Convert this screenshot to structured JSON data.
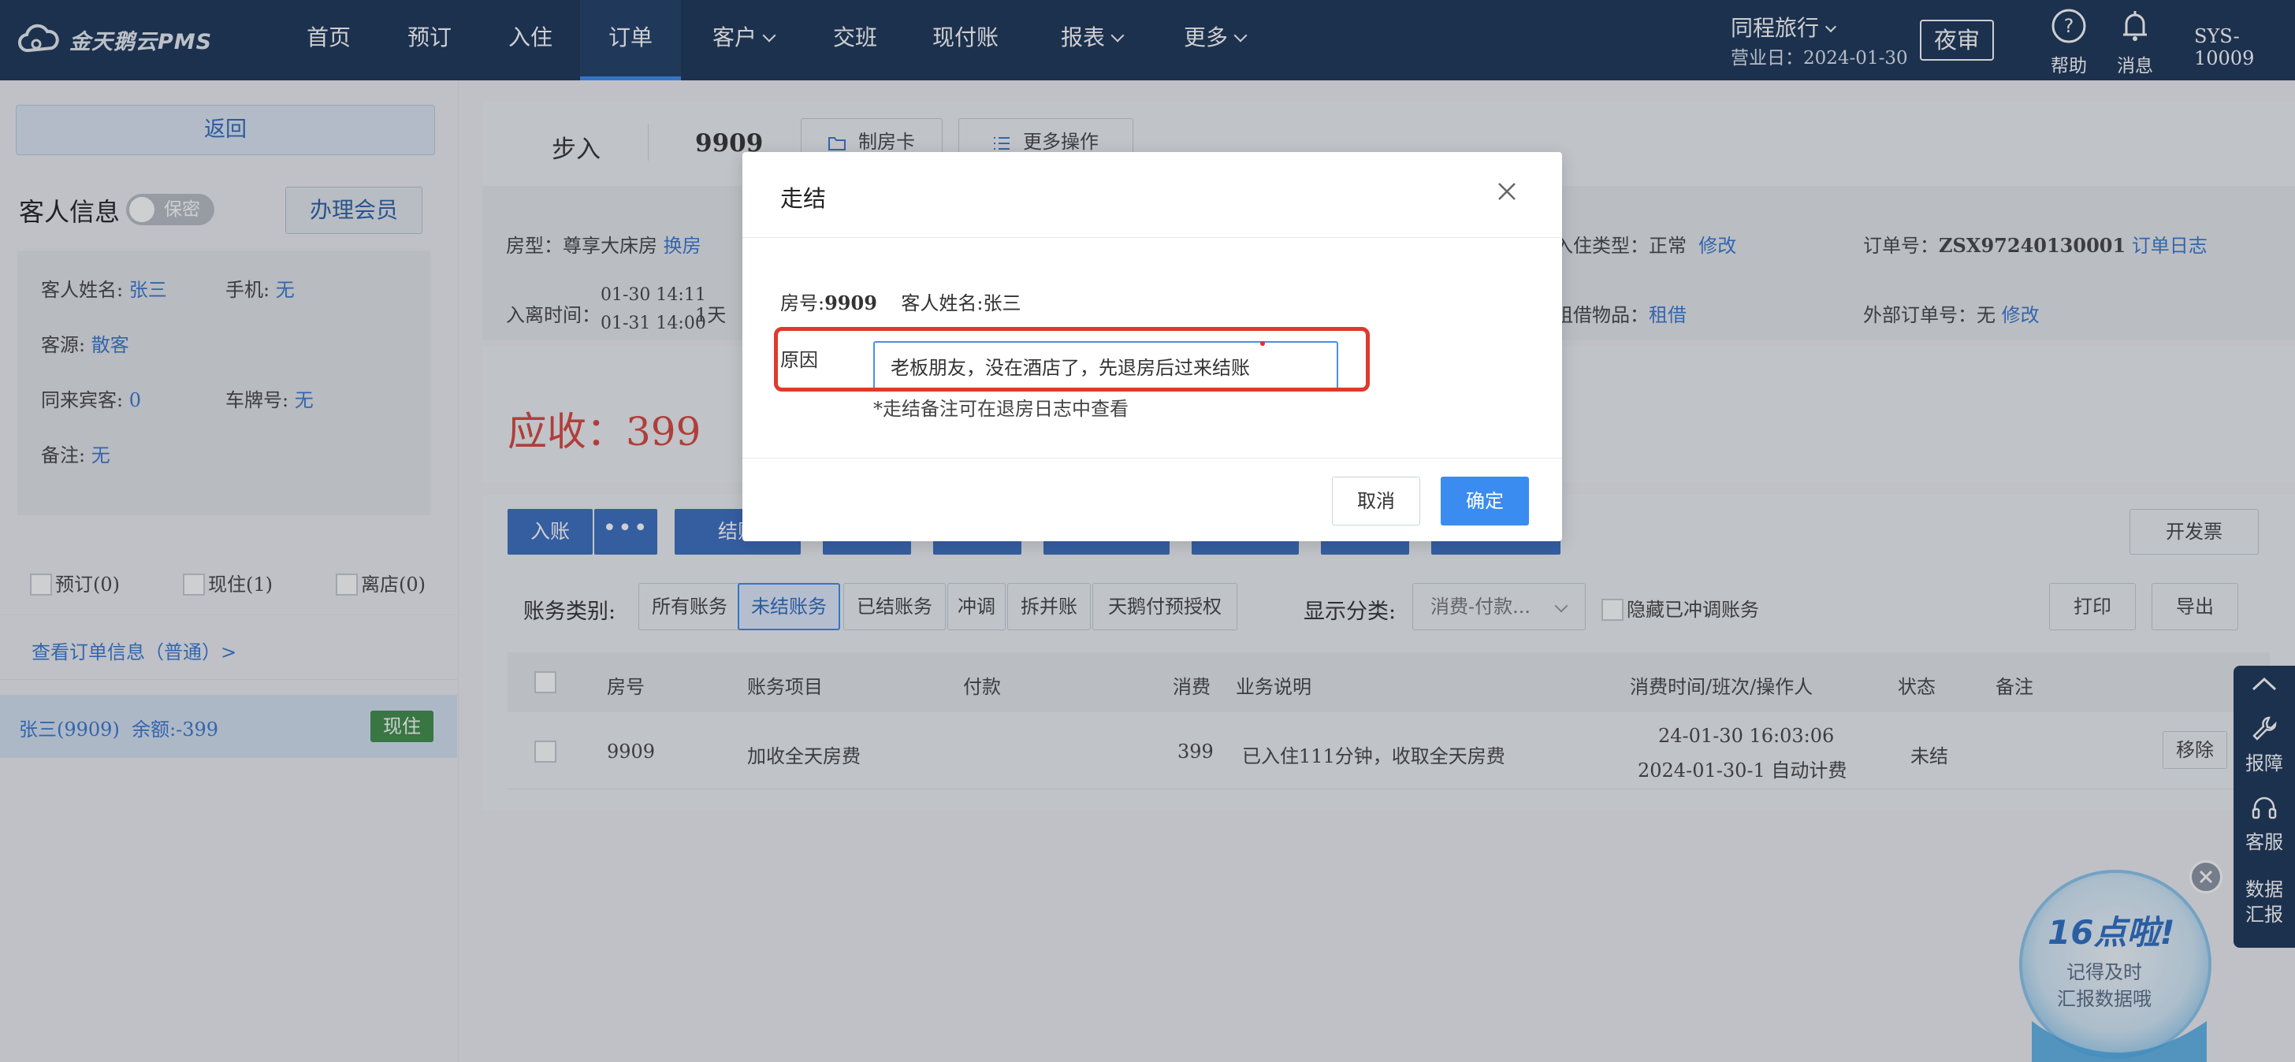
{
  "app": {
    "logo_text": "金天鹅云PMS"
  },
  "nav": {
    "items": [
      {
        "label": "首页"
      },
      {
        "label": "预订"
      },
      {
        "label": "入住"
      },
      {
        "label": "订单"
      },
      {
        "label": "客户"
      },
      {
        "label": "交班"
      },
      {
        "label": "现付账"
      },
      {
        "label": "报表"
      },
      {
        "label": "更多"
      }
    ],
    "org": "同程旅行",
    "business_day": "营业日：2024-01-30",
    "night_audit": "夜审",
    "help": "帮助",
    "messages": "消息",
    "user": "SYS-10009"
  },
  "left": {
    "back": "返回",
    "guest_info_title": "客人信息",
    "privacy_label": "保密",
    "member_button": "办理会员",
    "name_label": "客人姓名:",
    "name": "张三",
    "phone_label": "手机:",
    "phone": "无",
    "source_label": "客源:",
    "source": "散客",
    "companions_label": "同来宾客:",
    "companions": "0",
    "plate_label": "车牌号:",
    "plate": "无",
    "remark_label": "备注:",
    "remark": "无",
    "tab_reserve": "预订(0)",
    "tab_current": "现住(1)",
    "tab_left": "离店(0)",
    "order_info_link": "查看订单信息（普通）>",
    "guest_row_name": "张三(9909)",
    "guest_row_balance": "余额:-399",
    "guest_row_status": "现住"
  },
  "main": {
    "walkin": "步入",
    "room_no": "9909",
    "make_card": "制房卡",
    "more_ops": "更多操作",
    "room_type_label": "房型：",
    "room_type": "尊享大床房",
    "change_room": "换房",
    "checkin_label": "入离时间：",
    "checkin_time": "01-30 14:11",
    "checkout_time": "01-31 14:00",
    "nights": "1天",
    "stay_type_label": "入住类型：",
    "stay_type": "正常",
    "modify": "修改",
    "order_no_label": "订单号：",
    "order_no": "ZSX97240130001",
    "order_log": "订单日志",
    "borrow_label": "租借物品：",
    "borrow": "租借",
    "ext_order_label": "外部订单号：",
    "ext_order": "无",
    "modify2": "修改",
    "receivable_label": "应收：",
    "receivable": "399",
    "post_btn": "入账",
    "checkout_btn": "结账",
    "invoice_btn": "开发票",
    "category_label": "账务类别:",
    "cat_tabs": [
      "所有账务",
      "未结账务",
      "已结账务",
      "冲调",
      "拆并账",
      "天鹅付预授权"
    ],
    "display_label": "显示分类:",
    "display_value": "消费-付款...",
    "hide_label": "隐藏已冲调账务",
    "print": "打印",
    "export": "导出",
    "columns": [
      "房号",
      "账务项目",
      "付款",
      "消费",
      "业务说明",
      "消费时间/班次/操作人",
      "状态",
      "备注"
    ],
    "rows": [
      {
        "room": "9909",
        "item": "加收全天房费",
        "pay": "",
        "consume": "399",
        "desc": "已入住111分钟，收取全天房费",
        "time1": "24-01-30 16:03:06",
        "time2": "2024-01-30-1 自动计费",
        "status": "未结",
        "action": "移除"
      }
    ]
  },
  "modal": {
    "title": "走结",
    "room_label": "房号:",
    "room": "9909",
    "guest_label": "客人姓名:",
    "guest": "张三",
    "reason_label": "原因",
    "reason_value": "老板朋友，没在酒店了，先退房后过来结账",
    "hint": "*走结备注可在退房日志中查看",
    "cancel": "取消",
    "ok": "确定"
  },
  "float": {
    "report": "报障",
    "service": "客服",
    "data_report_1": "数据",
    "data_report_2": "汇报",
    "badge_title": "16点啦!",
    "badge_line1": "记得及时",
    "badge_line2": "汇报数据哦"
  },
  "colors": {
    "nav_bg": "#1b3558",
    "accent": "#3b8cf0",
    "danger": "#e0392d",
    "receivable": "#d9463f",
    "success": "#3f8d4a"
  }
}
